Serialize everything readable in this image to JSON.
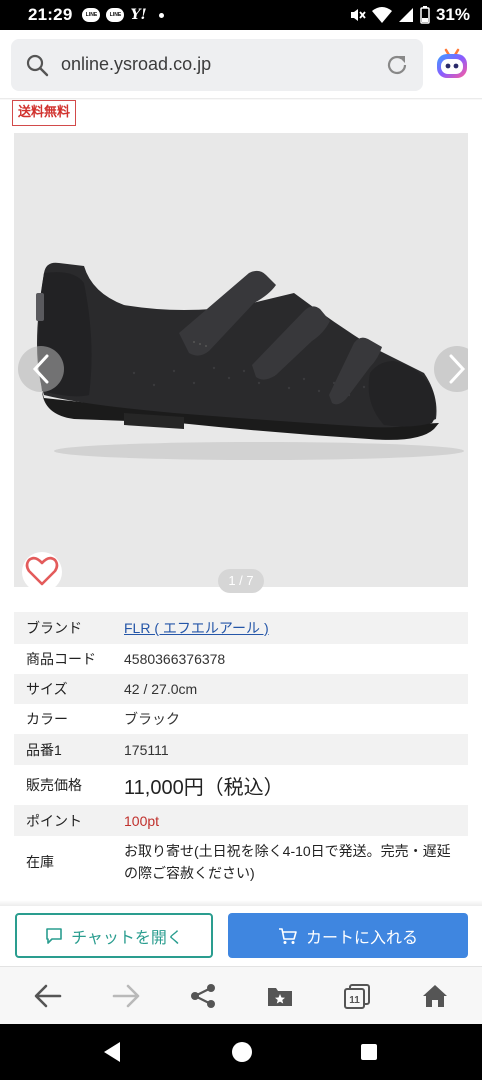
{
  "status_bar": {
    "time": "21:29",
    "app_icons": [
      "LINE",
      "LINE"
    ],
    "yahoo": "Y!",
    "battery": "31%"
  },
  "browser": {
    "url": "online.ysroad.co.jp"
  },
  "product": {
    "free_shipping_badge": "送料無料",
    "image_counter": "1 / 7",
    "specs": [
      {
        "label": "ブランド",
        "value": "FLR ( エフエルアール )"
      },
      {
        "label": "商品コード",
        "value": "4580366376378"
      },
      {
        "label": "サイズ",
        "value": "42 / 27.0cm"
      },
      {
        "label": "カラー",
        "value": "ブラック"
      },
      {
        "label": "品番1",
        "value": "175111"
      },
      {
        "label": "販売価格",
        "value": "11,000円（税込）"
      },
      {
        "label": "ポイント",
        "value": "100pt"
      },
      {
        "label": "在庫",
        "value": "お取り寄せ(土日祝を除く4-10日で発送。完売・遅延の際ご容赦ください)"
      }
    ]
  },
  "actions": {
    "chat_label": "チャットを開く",
    "cart_label": "カートに入れる"
  },
  "nav_bar": {
    "tabs_count": "11"
  },
  "colors": {
    "accent_teal": "#2a9d8f",
    "cart_blue": "#3f86e0",
    "badge_red": "#d1322e",
    "link_blue": "#2556a8"
  }
}
